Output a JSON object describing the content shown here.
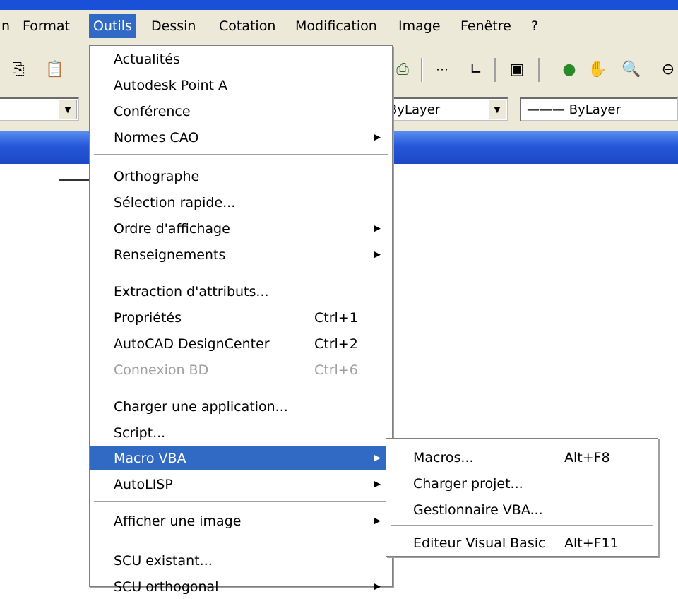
{
  "menubar": {
    "items": [
      {
        "label": "n"
      },
      {
        "label": "Format"
      },
      {
        "label": "Outils"
      },
      {
        "label": "Dessin"
      },
      {
        "label": "Cotation"
      },
      {
        "label": "Modification"
      },
      {
        "label": "Image"
      },
      {
        "label": "Fenêtre"
      },
      {
        "label": "?"
      }
    ]
  },
  "toolbar": {
    "layer_combo": "ByLayer",
    "linetype_combo": "——— ByLayer",
    "icons": [
      "copy-icon",
      "paste-icon",
      "plot-icon",
      "distance-icon",
      "ucs-icon",
      "zoom-window-icon",
      "orbit-icon",
      "pan-icon",
      "zoom-realtime-icon"
    ]
  },
  "outils_menu": {
    "items": [
      {
        "label": "Actualités",
        "shortcut": "",
        "submenu": false,
        "disabled": false
      },
      {
        "label": "Autodesk Point A",
        "shortcut": "",
        "submenu": false,
        "disabled": false
      },
      {
        "label": "Conférence",
        "shortcut": "",
        "submenu": false,
        "disabled": false
      },
      {
        "label": "Normes CAO",
        "shortcut": "",
        "submenu": true,
        "disabled": false
      },
      {
        "label": "Orthographe",
        "shortcut": "",
        "submenu": false,
        "disabled": false
      },
      {
        "label": "Sélection rapide...",
        "shortcut": "",
        "submenu": false,
        "disabled": false
      },
      {
        "label": "Ordre d'affichage",
        "shortcut": "",
        "submenu": true,
        "disabled": false
      },
      {
        "label": "Renseignements",
        "shortcut": "",
        "submenu": true,
        "disabled": false
      },
      {
        "label": "Extraction d'attributs...",
        "shortcut": "",
        "submenu": false,
        "disabled": false
      },
      {
        "label": "Propriétés",
        "shortcut": "Ctrl+1",
        "submenu": false,
        "disabled": false
      },
      {
        "label": "AutoCAD DesignCenter",
        "shortcut": "Ctrl+2",
        "submenu": false,
        "disabled": false
      },
      {
        "label": "Connexion BD",
        "shortcut": "Ctrl+6",
        "submenu": false,
        "disabled": true
      },
      {
        "label": "Charger une application...",
        "shortcut": "",
        "submenu": false,
        "disabled": false
      },
      {
        "label": "Script...",
        "shortcut": "",
        "submenu": false,
        "disabled": false
      },
      {
        "label": "Macro VBA",
        "shortcut": "",
        "submenu": true,
        "disabled": false,
        "highlighted": true
      },
      {
        "label": "AutoLISP",
        "shortcut": "",
        "submenu": true,
        "disabled": false
      },
      {
        "label": "Afficher une image",
        "shortcut": "",
        "submenu": true,
        "disabled": false
      },
      {
        "label": "SCU existant...",
        "shortcut": "",
        "submenu": false,
        "disabled": false
      },
      {
        "label": "SCU orthogonal",
        "shortcut": "",
        "submenu": true,
        "disabled": false
      }
    ]
  },
  "macro_submenu": {
    "items": [
      {
        "label": "Macros...",
        "shortcut": "Alt+F8"
      },
      {
        "label": "Charger projet...",
        "shortcut": ""
      },
      {
        "label": "Gestionnaire VBA...",
        "shortcut": ""
      },
      {
        "label": "Editeur Visual Basic",
        "shortcut": "Alt+F11"
      }
    ]
  },
  "colors": {
    "highlight": "#316ac5",
    "menubar_bg": "#ece9d8",
    "title_blue": "#1c49c4",
    "disabled_text": "#a0a0a0"
  }
}
